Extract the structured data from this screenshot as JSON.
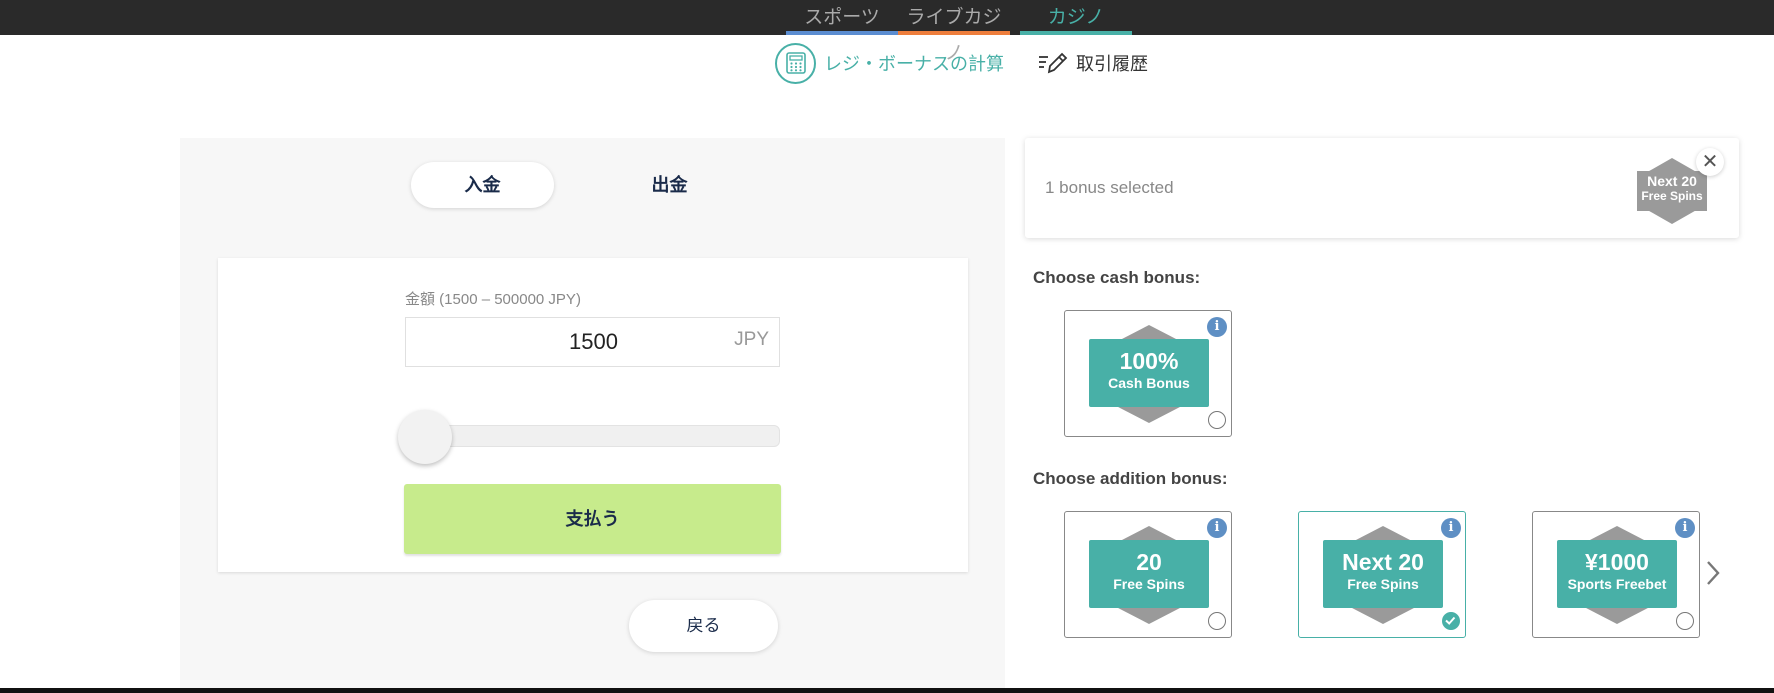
{
  "nav": {
    "tabs": [
      {
        "label": "スポーツ",
        "color": "#5b8dd1"
      },
      {
        "label": "ライブカジノ",
        "color": "#ee7e3c"
      },
      {
        "label": "カジノ",
        "color": "#48b0a7",
        "active": true
      }
    ]
  },
  "subnav": {
    "calculator": "レジ・ボーナスの計算",
    "history": "取引履歴"
  },
  "cashier": {
    "deposit_tab": "入金",
    "withdraw_tab": "出金",
    "amount_label": "金額 (1500 – 500000 JPY)",
    "amount_value": "1500",
    "currency": "JPY",
    "slider_value": 0,
    "pay_button": "支払う",
    "back_button": "戻る"
  },
  "bonus": {
    "selected_text": "1 bonus selected",
    "selected_badge": {
      "line1": "Next 20",
      "line2": "Free Spins"
    },
    "cash_title": "Choose cash bonus:",
    "cash_bonuses": [
      {
        "big": "100%",
        "small": "Cash Bonus",
        "selected": false
      }
    ],
    "addition_title": "Choose addition bonus:",
    "addition_bonuses": [
      {
        "big": "20",
        "small": "Free Spins",
        "selected": false
      },
      {
        "big": "Next 20",
        "small": "Free Spins",
        "selected": true
      },
      {
        "big": "¥1000",
        "small": "Sports Freebet",
        "selected": false
      }
    ],
    "info_icon": "i"
  },
  "colors": {
    "accent": "#48b0a7",
    "pay_button": "#c7eb8c",
    "info": "#5e8fc4"
  }
}
